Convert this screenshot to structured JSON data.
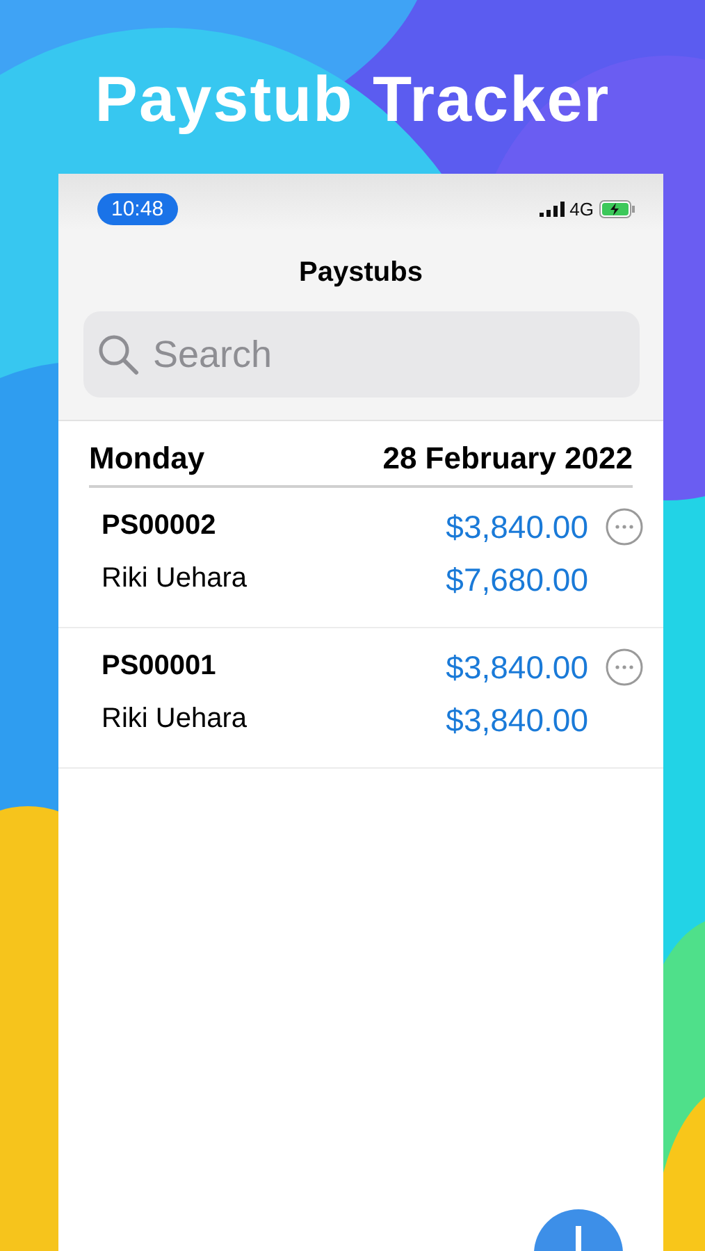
{
  "app_title": "Paystub Tracker",
  "status_bar": {
    "time": "10:48",
    "network": "4G"
  },
  "nav_title": "Paystubs",
  "search": {
    "placeholder": "Search"
  },
  "section": {
    "day": "Monday",
    "date": "28 February 2022"
  },
  "rows": [
    {
      "id": "PS00002",
      "name": "Riki Uehara",
      "amount": "$3,840.00",
      "total": "$7,680.00"
    },
    {
      "id": "PS00001",
      "name": "Riki Uehara",
      "amount": "$3,840.00",
      "total": "$3,840.00"
    }
  ]
}
